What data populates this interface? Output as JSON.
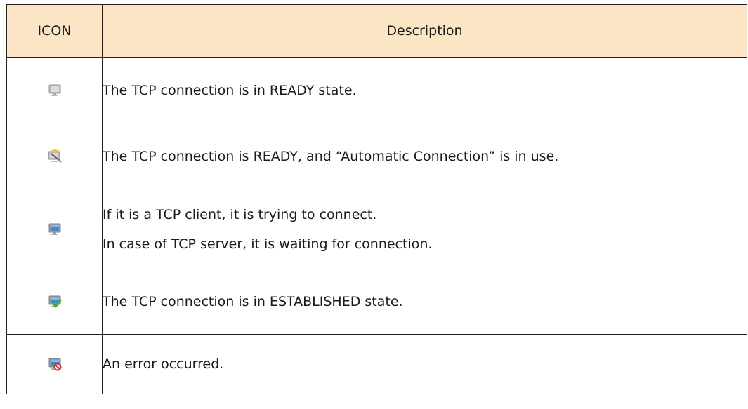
{
  "table": {
    "header": {
      "icon": "ICON",
      "description": "Description"
    },
    "rows": [
      {
        "icon": "monitor-gray-icon",
        "lines": [
          "The TCP connection is in READY state."
        ]
      },
      {
        "icon": "monitor-auto-connect-icon",
        "lines": [
          "The TCP connection is READY, and “Automatic Connection” is in use."
        ]
      },
      {
        "icon": "monitor-blue-icon",
        "lines": [
          "If it is a TCP client, it is trying to connect.",
          "In case of TCP server, it is waiting for connection."
        ]
      },
      {
        "icon": "monitor-check-icon",
        "lines": [
          "The TCP connection is in ESTABLISHED state."
        ]
      },
      {
        "icon": "monitor-error-icon",
        "lines": [
          "An error occurred."
        ]
      }
    ]
  },
  "colors": {
    "header_bg": "#fbe5c4",
    "border": "#1f1f1f",
    "screen_gray": "#c9c9c9",
    "screen_blue": "#3a8bd8",
    "check_green": "#3fae2a",
    "error_red": "#d42a2a"
  }
}
